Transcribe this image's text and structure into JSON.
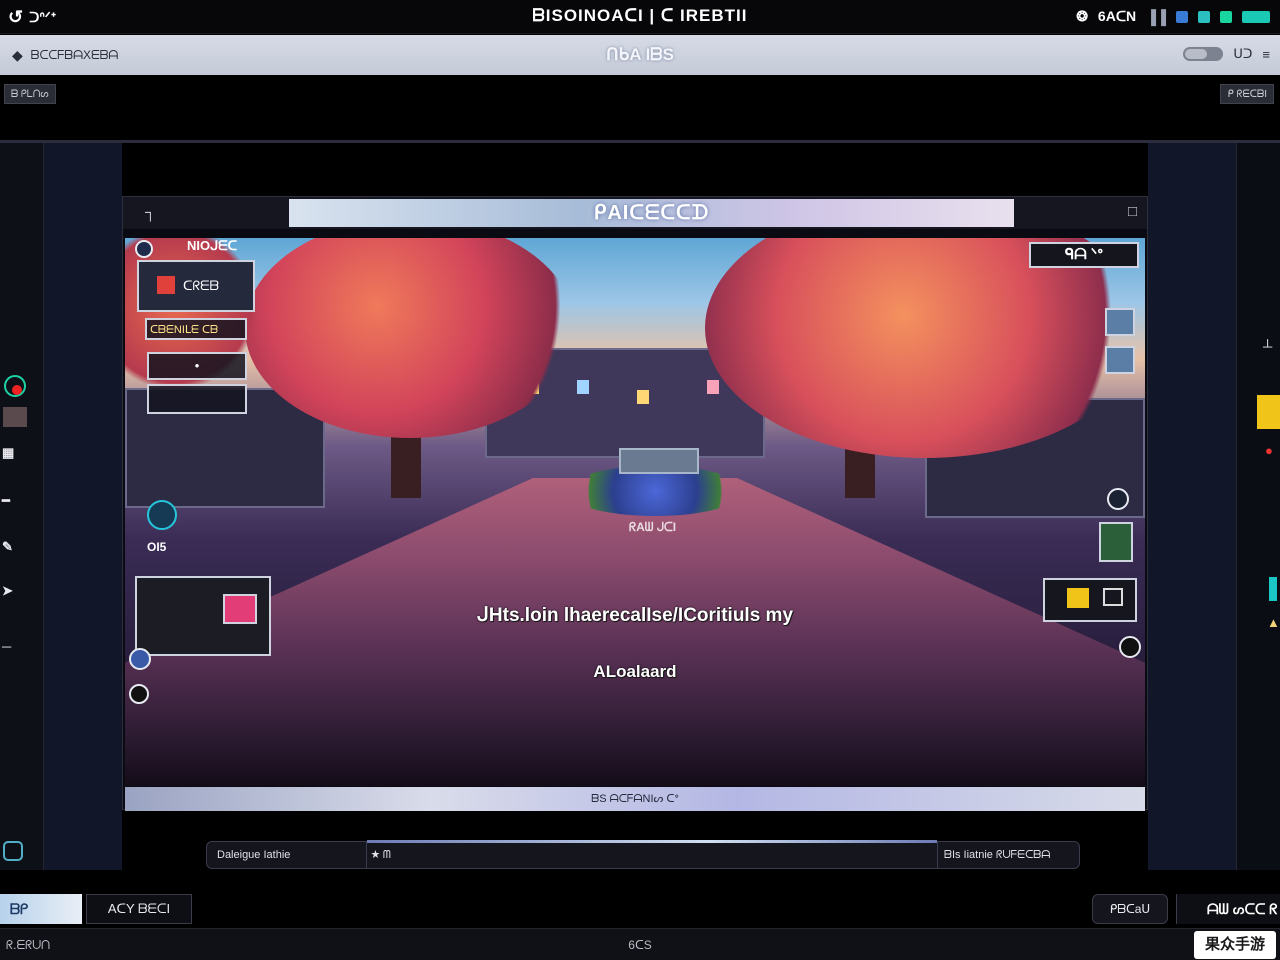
{
  "topbar": {
    "app_name": "ᑐᐢᐟᐩ",
    "title": "ᗷISOINOAᑕI | ᑕ IREBTII",
    "status_text": "6AᑕN",
    "accent_colors": [
      "#2bbfbf",
      "#19d6a0",
      "#3a7bd5"
    ]
  },
  "appbar": {
    "left_label": "ᗷᑕᑕᖴᗷᗩXᗴᗷᗩ",
    "title": "ᑎᑲA IᗷS",
    "right_label": "ᑌᑐ"
  },
  "tags": {
    "left": "ᗷ ᑭᒪᑎᔕ",
    "right": "ᑭ ᖇᗴᑕᗷI"
  },
  "game": {
    "window_title": "ᑭAIᑕᗴᑕᑕᗪ",
    "top_right_badge": "ᑫᗩ ᐠᐤ",
    "hud_title": "NIOᒍᗴᑕ",
    "hud_item_1": "ᑕᖇᗴᗷ",
    "hud_label": "ᑕᗷᗴNIᒪᗴ ᑕᗷ",
    "scene_sign": "ᖇAᗯ ᒍᑕI",
    "subtitle_line1": "ᒍHts.loin lhaerecalIse/ICoritiuls my",
    "subtitle_line2": "ALoalaard",
    "progress_text": "ᗷS ᗩᑕᖴᗩNIᔕ ᑕᐤ",
    "bottom_left_icon_label": "OI5"
  },
  "statusbar": {
    "seg1": "Daleigue Iathie",
    "seg2": "★ ᗰ",
    "seg3": "ᗷIs Iiatnie ᖇᑌᖴᗴᑕᗷᗩ"
  },
  "bottom_buttons": {
    "btn_a": "ᗷᑭ",
    "btn_b": "AᑕY ᗷᗴᑕI",
    "btn_c": "ᑭᗷᑕaᑌ",
    "btn_d": "ᗩᗯ ᔕᑕᑕ ᖇ"
  },
  "footer": {
    "left": "ᖇ.ᗴᖇᑌᑎ",
    "center": "6ᑕS",
    "watermark": "果众手游"
  }
}
